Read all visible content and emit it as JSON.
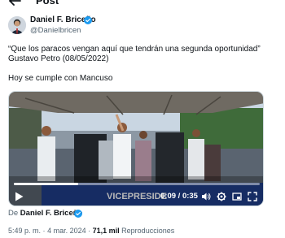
{
  "header": {
    "title": "Post"
  },
  "author": {
    "name": "Daniel F. Briceño",
    "handle": "@Danielbricen"
  },
  "tweet": {
    "line1": "“Que los paracos vengan aquí que tendrán una segunda oportunidad”",
    "line2": "Gustavo Petro (08/05/2022)",
    "line3": "Hoy se cumple con Mancuso"
  },
  "video": {
    "elapsed": "0:09",
    "total": "0:35",
    "progress_fraction": 0.26,
    "banner_text": "VICEPRESIDE"
  },
  "source": {
    "prefix": "De",
    "name": "Daniel F. Briceño"
  },
  "meta": {
    "time": "5:49 p. m.",
    "sep": "·",
    "date": "4 mar. 2024",
    "views": "71,1 mil",
    "views_label": "Reproducciones"
  },
  "colors": {
    "verified": "#1d9bf0",
    "text": "#0f1419",
    "muted": "#536471"
  },
  "icons": [
    "back-arrow-icon",
    "verified-icon",
    "play-icon",
    "volume-icon",
    "settings-icon",
    "picture-in-picture-icon",
    "fullscreen-icon"
  ]
}
